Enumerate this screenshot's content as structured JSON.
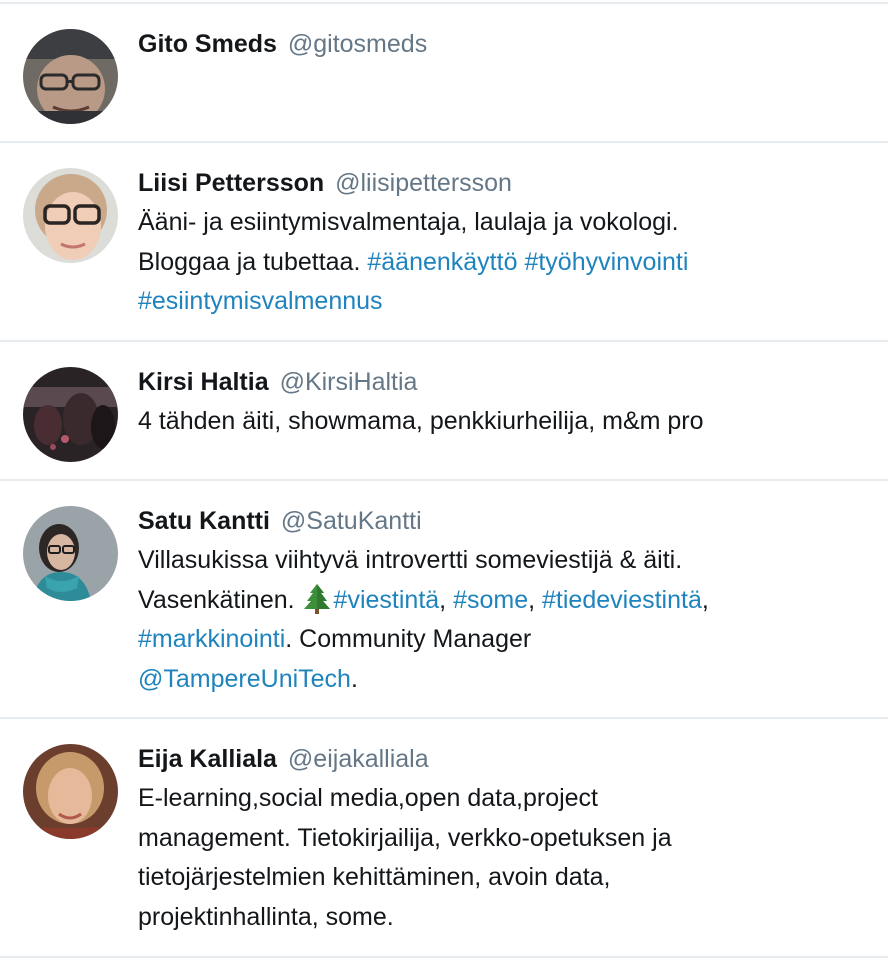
{
  "colors": {
    "name": "#14171a",
    "handle": "#657786",
    "link": "#1f83bd",
    "divider": "#e6ecf0"
  },
  "users": [
    {
      "name": "Gito Smeds",
      "handle": "@gitosmeds",
      "avatar_icon": "avatar-photo"
    },
    {
      "name": "Liisi Pettersson",
      "handle": "@liisipettersson",
      "avatar_icon": "avatar-photo",
      "bio": {
        "line1": "Ääni- ja esiintymisvalmentaja, laulaja ja vokologi.",
        "line2_text": "Bloggaa ja tubettaa.",
        "hashtag1": "#äänenkäyttö",
        "hashtag2": "#työhyvinvointi",
        "hashtag3": "#esiintymisvalmennus"
      }
    },
    {
      "name": "Kirsi Haltia",
      "handle": "@KirsiHaltia",
      "avatar_icon": "avatar-photo",
      "bio": {
        "line1": "4 tähden äiti, showmama, penkkiurheilija, m&m pro"
      }
    },
    {
      "name": "Satu Kantti",
      "handle": "@SatuKantti",
      "avatar_icon": "avatar-photo",
      "bio": {
        "line1": "Villasukissa viihtyvä introvertti someviestijä & äiti.",
        "line2_text": "Vasenkätinen.",
        "emoji_icon": "christmas-tree-icon",
        "hashtag1": "#viestintä",
        "hashtag2": "#some",
        "hashtag3": "#tiedeviestintä",
        "hashtag4": "#markkinointi",
        "line3_text": ". Community Manager",
        "mention": "@TampereUniTech",
        "line4_end": "."
      }
    },
    {
      "name": "Eija Kalliala",
      "handle": "@eijakalliala",
      "avatar_icon": "avatar-photo",
      "bio": {
        "line1": "E-learning,social media,open data,project",
        "line2": "management. Tietokirjailija, verkko-opetuksen ja",
        "line3": "tietojärjestelmien kehittäminen, avoin data,",
        "line4": "projektinhallinta, some."
      }
    }
  ]
}
